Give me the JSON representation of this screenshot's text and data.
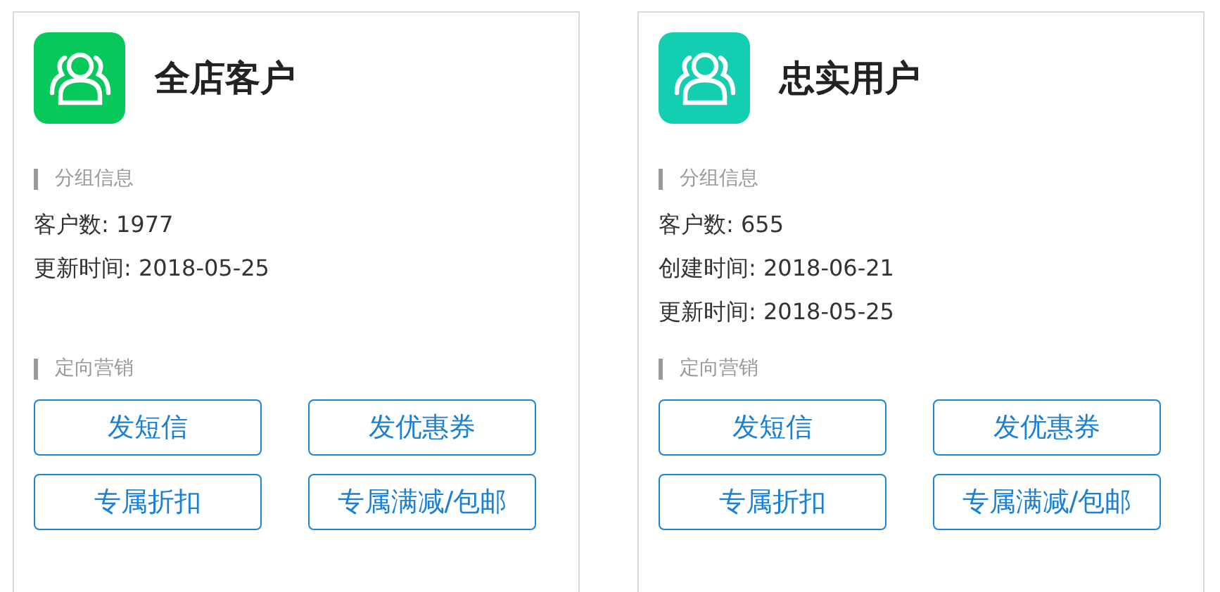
{
  "groups": [
    {
      "title": "全店客户",
      "color": "#07c95a",
      "info_heading": "分组信息",
      "info": [
        "客户数: 1977",
        "更新时间: 2018-05-25"
      ],
      "marketing_heading": "定向营销",
      "actions": [
        "发短信",
        "发优惠券",
        "专属折扣",
        "专属满减/包邮"
      ]
    },
    {
      "title": "忠实用户",
      "color": "#13ceb0",
      "info_heading": "分组信息",
      "info": [
        "客户数: 655",
        "创建时间: 2018-06-21",
        "更新时间: 2018-05-25"
      ],
      "marketing_heading": "定向营销",
      "actions": [
        "发短信",
        "发优惠券",
        "专属折扣",
        "专属满减/包邮"
      ]
    }
  ]
}
